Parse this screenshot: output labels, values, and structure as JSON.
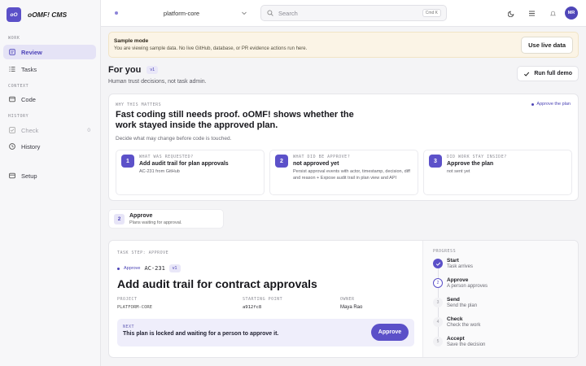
{
  "app": {
    "logo_text": "oO",
    "name": "oOMF! CMS"
  },
  "sidebar": {
    "sections": [
      {
        "label": "WORK"
      },
      {
        "label": "CONTEXT"
      },
      {
        "label": "HISTORY"
      }
    ],
    "items": [
      {
        "label": "Review",
        "icon": "review-icon",
        "state": "active"
      },
      {
        "label": "Tasks",
        "icon": "list-icon",
        "state": "normal"
      },
      {
        "label": "Code",
        "icon": "code-icon",
        "state": "normal"
      },
      {
        "label": "Check",
        "icon": "check-icon",
        "state": "disabled",
        "count": "0"
      },
      {
        "label": "History",
        "icon": "history-icon",
        "state": "normal"
      },
      {
        "label": "Setup",
        "icon": "setup-icon",
        "state": "normal"
      }
    ]
  },
  "topbar": {
    "project": "platform-core",
    "search_placeholder": "Search",
    "shortcut": "Cmd K",
    "avatar_initials": "MR"
  },
  "banner": {
    "title": "Sample mode",
    "text": "You are viewing sample data. No live GitHub, database, or PR evidence actions run here.",
    "button": "Use live data"
  },
  "header": {
    "title": "For you",
    "version": "v1",
    "subtitle": "Human trust decisions, not task admin.",
    "run_button": "Run full demo"
  },
  "why": {
    "label": "WHY THIS MATTERS",
    "link": "Approve the plan",
    "title": "Fast coding still needs proof. oOMF! shows whether the work stayed inside the approved plan.",
    "subtitle": "Decide what may change before code is touched.",
    "questions": [
      {
        "num": "1",
        "label": "WHAT WAS REQUESTED?",
        "title": "Add audit trail for plan approvals",
        "detail": "AC-231 from GitHub"
      },
      {
        "num": "2",
        "label": "WHAT DID BE APPROVE?",
        "title": "not approved yet",
        "detail": "Persist approval events with actor, timestamp, decision, diff and reason + Expose audit trail in plan view and API"
      },
      {
        "num": "3",
        "label": "DID WORK STAY INSIDE?",
        "title": "Approve the plan",
        "detail": "not sent yet"
      }
    ]
  },
  "stage": {
    "num": "2",
    "title": "Approve",
    "subtitle": "Plans waiting for approval."
  },
  "task": {
    "label": "TASK   STEP: APPROVE",
    "status": "Approve",
    "id": "AC-231",
    "version": "v1",
    "title": "Add audit trail for contract approvals",
    "meta": [
      {
        "label": "PROJECT",
        "value": "PLATFORM-CORE"
      },
      {
        "label": "STARTING POINT",
        "value": "a912fc8"
      },
      {
        "label": "OWNER",
        "value": "Maya Rao"
      }
    ],
    "next_label": "NEXT",
    "next_text": "This plan is locked and waiting for a person to approve it.",
    "approve_button": "Approve"
  },
  "progress": {
    "label": "PROGRESS",
    "steps": [
      {
        "num": "✓",
        "title": "Start",
        "sub": "Task arrives",
        "state": "done"
      },
      {
        "num": "2",
        "title": "Approve",
        "sub": "A person approves",
        "state": "current"
      },
      {
        "num": "3",
        "title": "Send",
        "sub": "Send the plan",
        "state": "todo"
      },
      {
        "num": "4",
        "title": "Check",
        "sub": "Check the work",
        "state": "todo"
      },
      {
        "num": "5",
        "title": "Accept",
        "sub": "Save the decision",
        "state": "todo"
      }
    ]
  },
  "colors": {
    "accent": "#5b50c8",
    "banner_bg": "#fbf4e6"
  }
}
